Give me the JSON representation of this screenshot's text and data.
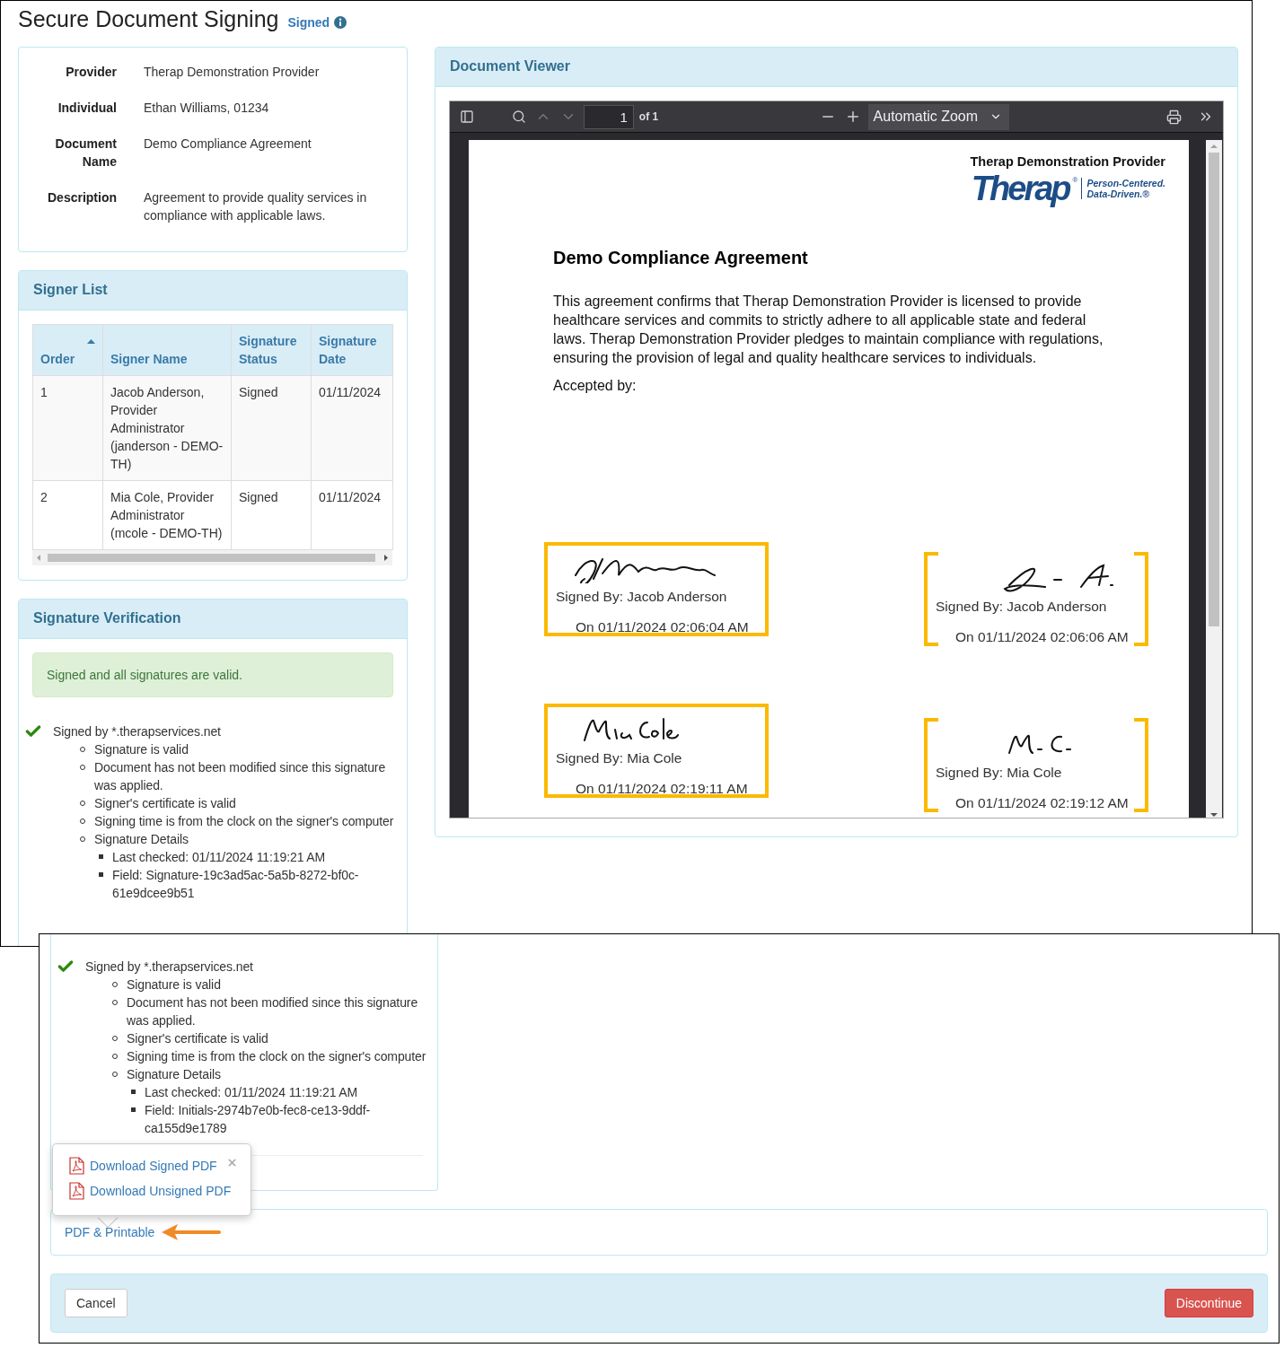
{
  "title": "Secure Document Signing",
  "status_badge": {
    "label": "Signed"
  },
  "details": [
    {
      "label": "Provider",
      "value": "Therap Demonstration Provider"
    },
    {
      "label": "Individual",
      "value": "Ethan Williams, 01234"
    },
    {
      "label": "Document Name",
      "value": "Demo Compliance Agreement"
    },
    {
      "label": "Description",
      "value": "Agreement to provide quality services in compliance with applicable laws."
    }
  ],
  "signer_list": {
    "title": "Signer List",
    "columns": [
      {
        "label": "Order",
        "sorted": true
      },
      {
        "label": "Signer Name",
        "sorted": false
      },
      {
        "label": "Signature Status",
        "sorted": false
      },
      {
        "label": "Signature Date",
        "sorted": false
      }
    ],
    "rows": [
      {
        "order": "1",
        "name": "Jacob Anderson, Provider Administrator (janderson - DEMO-TH)",
        "status": "Signed",
        "date": "01/11/2024"
      },
      {
        "order": "2",
        "name": "Mia Cole, Provider Administrator (mcole - DEMO-TH)",
        "status": "Signed",
        "date": "01/11/2024"
      }
    ]
  },
  "verification": {
    "title": "Signature Verification",
    "alert": "Signed and all signatures are valid.",
    "signature": {
      "signer": "Signed by *.therapservices.net",
      "items": [
        {
          "text": "Signature is valid"
        },
        {
          "text": "Document has not been modified since this signature was applied."
        },
        {
          "text": "Signer's certificate is valid"
        },
        {
          "text": "Signing time is from the clock on the signer's computer"
        },
        {
          "text": "Signature Details",
          "children": [
            {
              "text": "Last checked: 01/11/2024 11:19:21 AM"
            },
            {
              "text": "Field: Signature-19c3ad5ac-5a5b-8272-bf0c-61e9dcee9b51"
            }
          ]
        }
      ]
    }
  },
  "viewer": {
    "title": "Document Viewer",
    "page_number": "1",
    "page_count": "of 1",
    "zoom": "Automatic Zoom",
    "document": {
      "provider": "Therap Demonstration Provider",
      "logo": {
        "name": "Therap",
        "mark": "®",
        "tagline_1": "Person-Centered.",
        "tagline_2": "Data-Driven.®"
      },
      "heading": "Demo Compliance Agreement",
      "body": "This agreement confirms that Therap Demonstration Provider is licensed to provide healthcare services and commits to strictly adhere to all applicable state and federal laws. Therap Demonstration Provider pledges to maintain compliance with regulations, ensuring the provision of legal and quality healthcare services to individuals.",
      "accepted_by": "Accepted by:",
      "signatures": [
        {
          "kind": "box",
          "signed_by": "Signed By: Jacob Anderson",
          "date": "On 01/11/2024 02:06:04 AM"
        },
        {
          "kind": "bracket",
          "signed_by": "Signed By: Jacob Anderson",
          "date": "On 01/11/2024 02:06:06 AM"
        },
        {
          "kind": "box",
          "signed_by": "Signed By: Mia Cole",
          "date": "On 01/11/2024 02:19:11 AM"
        },
        {
          "kind": "bracket",
          "signed_by": "Signed By: Mia Cole",
          "date": "On 01/11/2024 02:19:12 AM"
        }
      ]
    }
  },
  "second_view": {
    "signature": {
      "signer": "Signed by *.therapservices.net",
      "items": [
        {
          "text": "Signature is valid"
        },
        {
          "text": "Document has not been modified since this signature was applied."
        },
        {
          "text": "Signer's certificate is valid"
        },
        {
          "text": "Signing time is from the clock on the signer's computer"
        },
        {
          "text": "Signature Details",
          "children": [
            {
              "text": "Last checked: 01/11/2024 11:19:21 AM"
            },
            {
              "text": "Field: Initials-2974b7e0b-fec8-ce13-9ddf-ca155d9e1789"
            }
          ]
        }
      ]
    },
    "popover": {
      "items": [
        {
          "label": "Download Signed PDF"
        },
        {
          "label": "Download Unsigned PDF"
        }
      ]
    },
    "pdf_link": "PDF & Printable",
    "buttons": [
      {
        "label": "Cancel",
        "kind": "default"
      },
      {
        "label": "Discontinue",
        "kind": "danger"
      }
    ]
  }
}
